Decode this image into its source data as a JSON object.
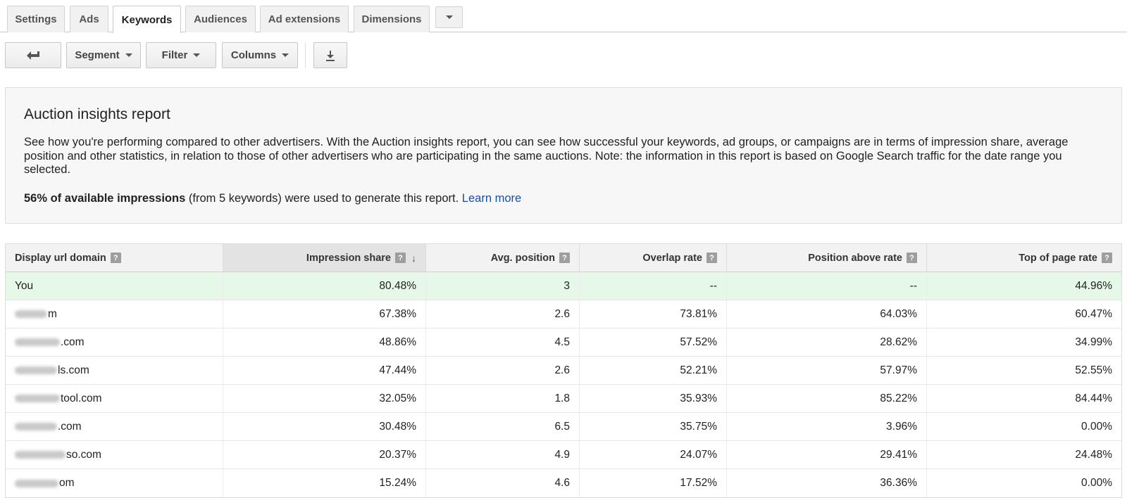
{
  "tabs": [
    {
      "label": "Settings"
    },
    {
      "label": "Ads"
    },
    {
      "label": "Keywords",
      "active": true
    },
    {
      "label": "Audiences"
    },
    {
      "label": "Ad extensions"
    },
    {
      "label": "Dimensions"
    }
  ],
  "toolbar": {
    "back_icon": "back-arrow-icon",
    "segment_label": "Segment",
    "filter_label": "Filter",
    "columns_label": "Columns",
    "download_icon": "download-icon"
  },
  "report": {
    "title": "Auction insights report",
    "description": "See how you're performing compared to other advertisers. With the Auction insights report, you can see how successful your keywords, ad groups, or campaigns are in terms of impression share, average position and other statistics, in relation to those of other advertisers who are participating in the same auctions. Note: the information in this report is based on Google Search traffic for the date range you selected.",
    "note_bold": "56% of available impressions",
    "note_text": " (from 5 keywords) were used to generate this report. ",
    "learn_more": "Learn more"
  },
  "table": {
    "headers": [
      "Display url domain",
      "Impression share",
      "Avg. position",
      "Overlap rate",
      "Position above rate",
      "Top of page rate"
    ],
    "rows": [
      {
        "domain": "You",
        "impression_share": "80.48%",
        "avg_position": "3",
        "overlap_rate": "--",
        "position_above_rate": "--",
        "top_of_page_rate": "44.96%"
      },
      {
        "domain": "m",
        "impression_share": "67.38%",
        "avg_position": "2.6",
        "overlap_rate": "73.81%",
        "position_above_rate": "64.03%",
        "top_of_page_rate": "60.47%"
      },
      {
        "domain": ".com",
        "impression_share": "48.86%",
        "avg_position": "4.5",
        "overlap_rate": "57.52%",
        "position_above_rate": "28.62%",
        "top_of_page_rate": "34.99%"
      },
      {
        "domain": "ls.com",
        "impression_share": "47.44%",
        "avg_position": "2.6",
        "overlap_rate": "52.21%",
        "position_above_rate": "57.97%",
        "top_of_page_rate": "52.55%"
      },
      {
        "domain": "tool.com",
        "impression_share": "32.05%",
        "avg_position": "1.8",
        "overlap_rate": "35.93%",
        "position_above_rate": "85.22%",
        "top_of_page_rate": "84.44%"
      },
      {
        "domain": ".com",
        "impression_share": "30.48%",
        "avg_position": "6.5",
        "overlap_rate": "35.75%",
        "position_above_rate": "3.96%",
        "top_of_page_rate": "0.00%"
      },
      {
        "domain": "so.com",
        "impression_share": "20.37%",
        "avg_position": "4.9",
        "overlap_rate": "24.07%",
        "position_above_rate": "29.41%",
        "top_of_page_rate": "24.48%"
      },
      {
        "domain": "om",
        "impression_share": "15.24%",
        "avg_position": "4.6",
        "overlap_rate": "17.52%",
        "position_above_rate": "36.36%",
        "top_of_page_rate": "0.00%"
      }
    ]
  },
  "colors": {
    "you_row_bg": "#e6f8e8",
    "link": "#1a4ea8"
  }
}
